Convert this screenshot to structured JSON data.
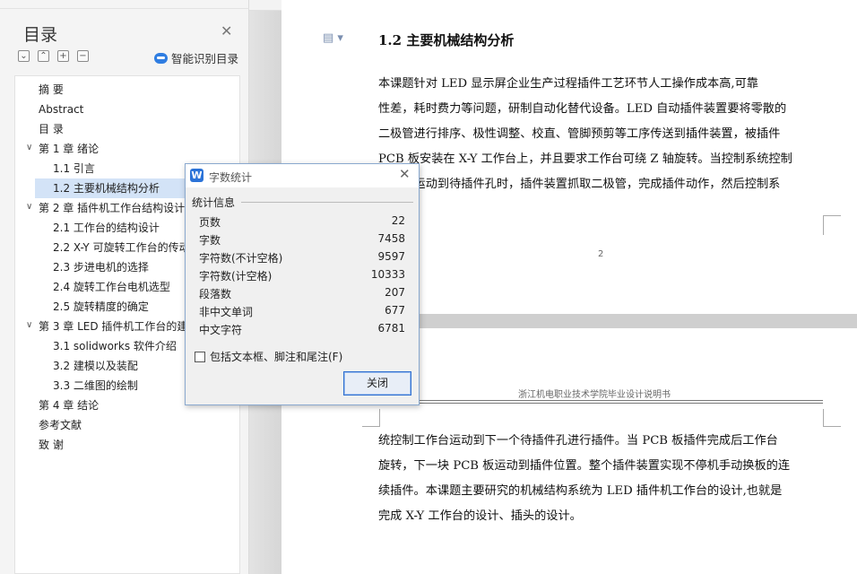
{
  "sidebar": {
    "title": "目录",
    "smart_toc_label": "智能识别目录",
    "tool_icons": [
      "⌄",
      "⌃",
      "+",
      "−"
    ],
    "items": [
      {
        "label": "摘    要"
      },
      {
        "label": "Abstract"
      },
      {
        "label": "目    录"
      },
      {
        "label": "第 1 章    绪论"
      },
      {
        "label": "1.1    引言"
      },
      {
        "label": "1.2    主要机械结构分析"
      },
      {
        "label": "第 2 章    插件机工作台结构设计"
      },
      {
        "label": "2.1 工作台的结构设计"
      },
      {
        "label": "2.2 X-Y 可旋转工作台的传动"
      },
      {
        "label": "2.3  步进电机的选择"
      },
      {
        "label": "2.4  旋转工作台电机选型"
      },
      {
        "label": "2.5 旋转精度的确定"
      },
      {
        "label": "第 3 章  LED 插件机工作台的建"
      },
      {
        "label": "3.1 solidworks 软件介绍"
      },
      {
        "label": "3.2 建模以及装配"
      },
      {
        "label": "3.3  二维图的绘制"
      },
      {
        "label": "第 4 章    结论"
      },
      {
        "label": "参考文献"
      },
      {
        "label": "致    谢"
      }
    ]
  },
  "document": {
    "heading": "1.2    主要机械结构分析",
    "para1_lines": [
      "    本课题针对 LED 显示屏企业生产过程插件工艺环节人工操作成本高,可靠",
      "性差，耗时费力等问题，研制自动化替代设备。LED 自动插件装置要将零散的",
      "二极管进行排序、极性调整、校直、管脚预剪等工序传送到插件装置，被插件",
      "PCB 板安装在 X-Y 工作台上，并且要求工作台可绕 Z 轴旋转。当控制系统控制",
      "工作台运动到待插件孔时，插件装置抓取二极管，完成插件动作，然后控制系"
    ],
    "page_number": "2",
    "header_text": "浙江机电职业技术学院毕业设计说明书",
    "para2_lines": [
      "统控制工作台运动到下一个待插件孔进行插件。当  PCB 板插件完成后工作台",
      "旋转，下一块 PCB 板运动到插件位置。整个插件装置实现不停机手动换板的连",
      "续插件。本课题主要研究的机械结构系统为 LED 插件机工作台的设计,也就是",
      "完成 X-Y 工作台的设计、插头的设计。"
    ]
  },
  "dialog": {
    "title": "字数统计",
    "group_label": "统计信息",
    "stats": [
      {
        "label": "页数",
        "value": "22"
      },
      {
        "label": "字数",
        "value": "7458"
      },
      {
        "label": "字符数(不计空格)",
        "value": "9597"
      },
      {
        "label": "字符数(计空格)",
        "value": "10333"
      },
      {
        "label": "段落数",
        "value": "207"
      },
      {
        "label": "非中文单词",
        "value": "677"
      },
      {
        "label": "中文字符",
        "value": "6781"
      }
    ],
    "checkbox_label": "包括文本框、脚注和尾注(F)",
    "checkbox_checked": false,
    "close_button": "关闭"
  },
  "colors": {
    "selected_toc": "#d3e3f7",
    "accent": "#2b73d8"
  }
}
